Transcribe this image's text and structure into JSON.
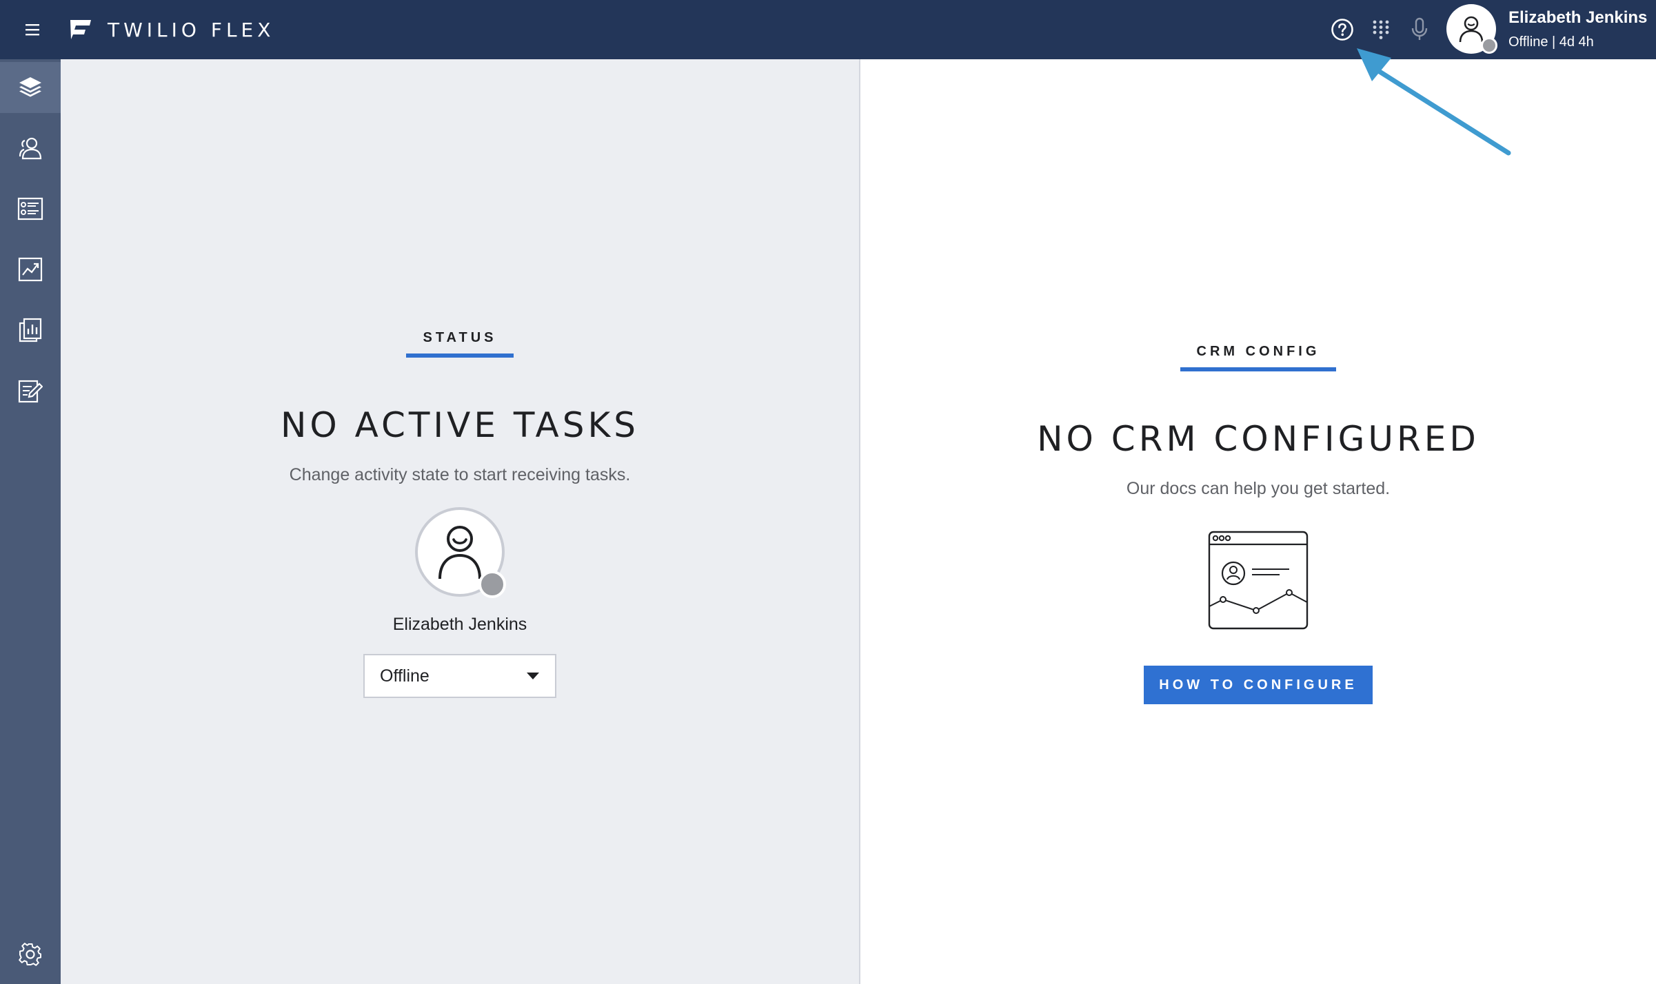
{
  "header": {
    "brand_name": "TWILIO FLEX",
    "user": {
      "name": "Elizabeth Jenkins",
      "status": "Offline | 4d 4h"
    },
    "icons": [
      "menu-icon",
      "twilio-flex-logo",
      "help-icon",
      "dialpad-icon",
      "microphone-icon",
      "user-avatar-icon"
    ]
  },
  "sidebar": {
    "items": [
      {
        "name": "task-layers-icon"
      },
      {
        "name": "teams-icon"
      },
      {
        "name": "queue-stats-icon"
      },
      {
        "name": "insights-chart-icon"
      },
      {
        "name": "reports-icon"
      },
      {
        "name": "assessments-icon"
      }
    ],
    "footer_icon": "settings-gear-icon"
  },
  "status_panel": {
    "section_label": "STATUS",
    "title": "NO ACTIVE TASKS",
    "subtitle": "Change activity state to start receiving tasks.",
    "agent_name": "Elizabeth Jenkins",
    "activity": {
      "selected": "Offline"
    }
  },
  "crm_panel": {
    "section_label": "CRM CONFIG",
    "title": "NO CRM CONFIGURED",
    "subtitle": "Our docs can help you get started.",
    "button_label": "HOW TO CONFIGURE"
  },
  "colors": {
    "header_bg": "#233659",
    "sidebar_bg": "#4a5a77",
    "left_panel_bg": "#eceef2",
    "accent": "#2f71d2",
    "offline_dot": "#9a9ca1",
    "annotation_arrow": "#3f9bd0"
  }
}
